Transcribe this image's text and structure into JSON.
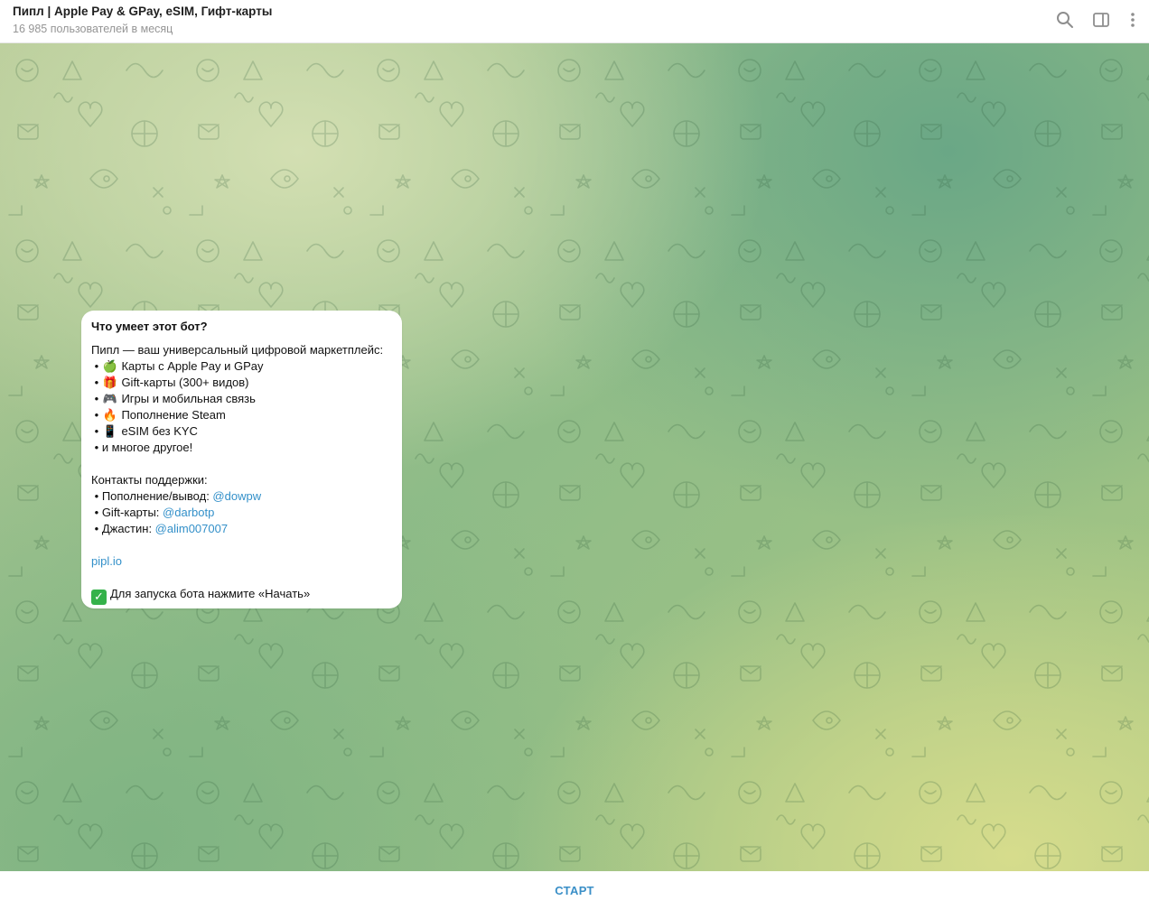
{
  "header": {
    "title": "Пипл | Apple Pay & GPay, eSIM, Гифт-карты",
    "subtitle": "16 985 пользователей в месяц",
    "icons": [
      "search-icon",
      "sidebar-toggle-icon",
      "more-vertical-icon"
    ]
  },
  "message": {
    "title": "Что умеет этот бот?",
    "intro": "Пипл — ваш универсальный цифровой маркетплейс:",
    "features": [
      {
        "bullet": "•",
        "emoji": "🍏",
        "text": "Карты с Apple Pay и GPay"
      },
      {
        "bullet": "•",
        "emoji": "🎁",
        "text": "Gift-карты (300+ видов)"
      },
      {
        "bullet": "•",
        "emoji": "🎮",
        "text": "Игры и мобильная связь"
      },
      {
        "bullet": "•",
        "emoji": "🔥",
        "text": "Пополнение Steam"
      },
      {
        "bullet": "•",
        "emoji": "📱",
        "text": "eSIM без KYC"
      },
      {
        "bullet": "•",
        "emoji": "",
        "text": "и многое другое!"
      }
    ],
    "contacts_title": "Контакты поддержки:",
    "contacts": [
      {
        "bullet": "•",
        "label": "Пополнение/вывод: ",
        "handle": "@dowpw"
      },
      {
        "bullet": "•",
        "label": "Gift-карты: ",
        "handle": "@darbotp"
      },
      {
        "bullet": "•",
        "label": "Джастин: ",
        "handle": "@alim007007"
      }
    ],
    "website": "pipl.io",
    "check_mark": "✓",
    "cta": "Для запуска бота нажмите «Начать»"
  },
  "footer": {
    "start_label": "СТАРТ"
  },
  "colors": {
    "accent": "#3a8fc7",
    "link": "#3390c9",
    "check": "#35b24a",
    "header_title": "#1f1f1f",
    "header_subtitle": "#959595"
  }
}
